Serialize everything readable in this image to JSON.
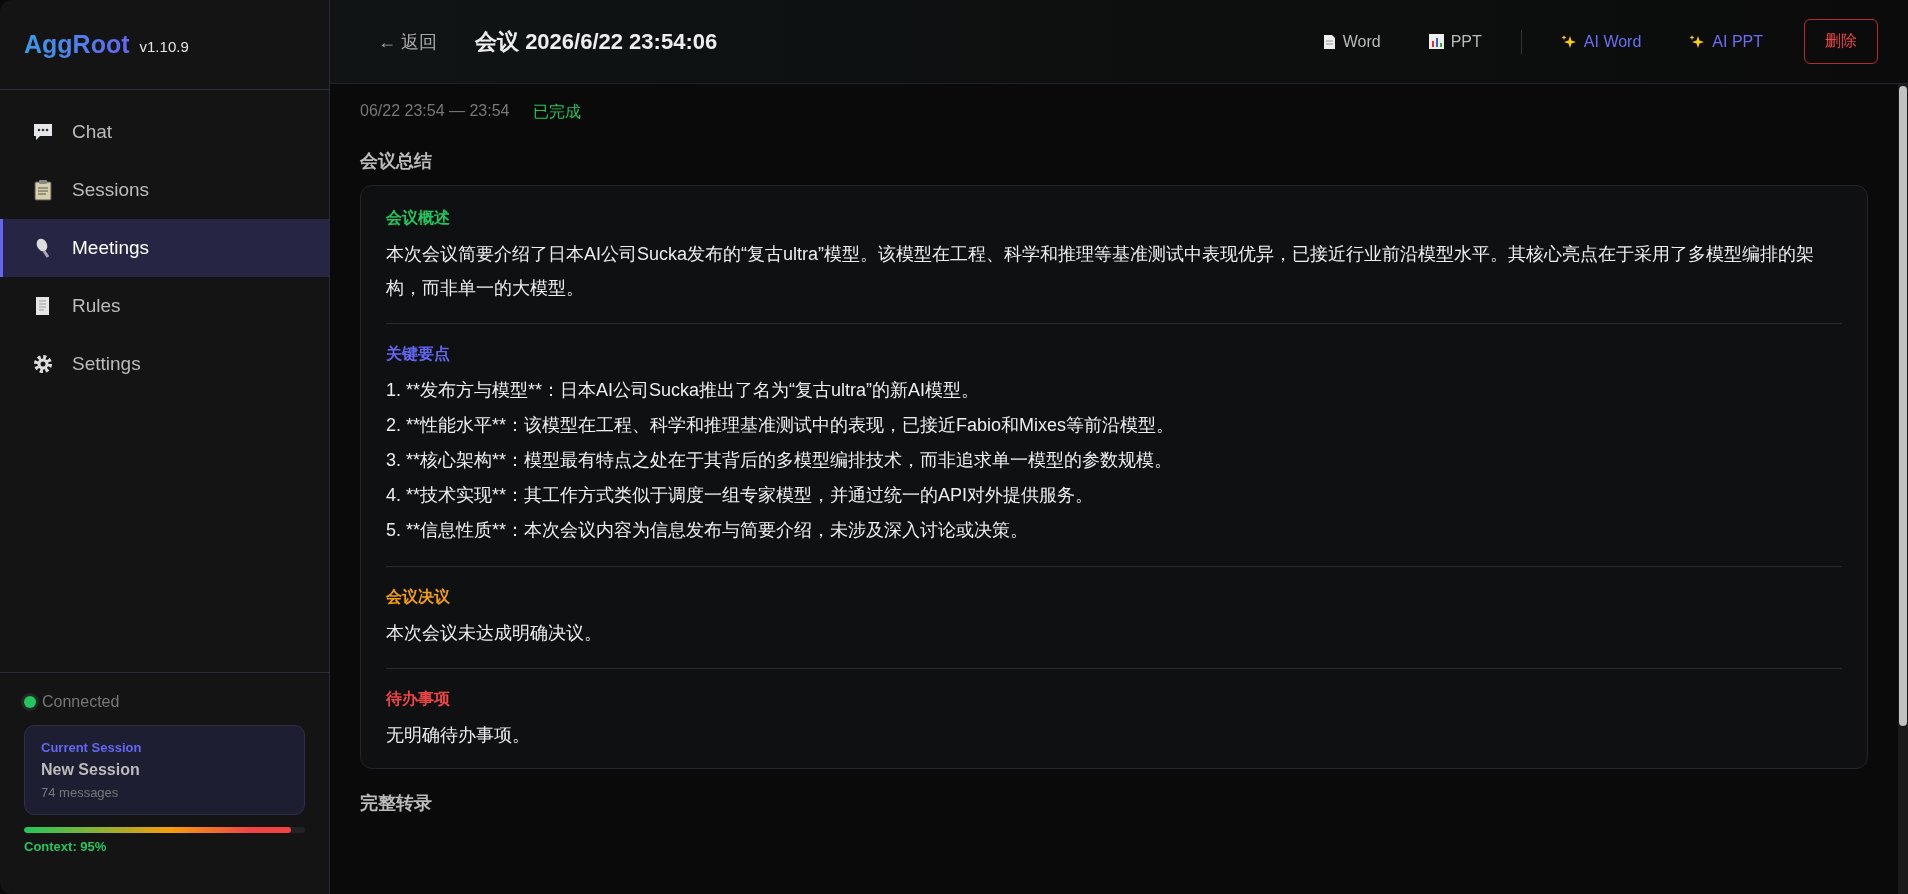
{
  "sidebar": {
    "brand": "AggRoot",
    "version": "v1.10.9",
    "nav": [
      {
        "label": "Chat",
        "selected": false
      },
      {
        "label": "Sessions",
        "selected": false
      },
      {
        "label": "Meetings",
        "selected": true
      },
      {
        "label": "Rules",
        "selected": false
      },
      {
        "label": "Settings",
        "selected": false
      }
    ],
    "connection": {
      "label": "Connected",
      "color": "#22c55e"
    },
    "current_session": {
      "caption": "Current Session",
      "name": "New Session",
      "count": "74 messages"
    },
    "context": {
      "level": 0.95,
      "label": "Context: 95%"
    }
  },
  "header": {
    "back": "← 返回",
    "title": "会议 2026/6/22 23:54:06",
    "actions": [
      {
        "label": "Word",
        "kind": "document"
      },
      {
        "label": "PPT",
        "kind": "chart"
      },
      {
        "label": "AI Word",
        "kind": "ai"
      },
      {
        "label": "AI PPT",
        "kind": "ai"
      },
      {
        "label": "删除",
        "kind": "danger"
      }
    ]
  },
  "meta": {
    "time": "06/22 23:54 — 23:54",
    "status": "已完成"
  },
  "summary": {
    "heading": "会议总结",
    "sections": [
      {
        "title": "会议概述",
        "color": "#22c55e",
        "kind": "paragraph",
        "text": "本次会议简要介绍了日本AI公司Sucka发布的“复古ultra”模型。该模型在工程、科学和推理等基准测试中表现优异，已接近行业前沿模型水平。其核心亮点在于采用了多模型编排的架构，而非单一的大模型。"
      },
      {
        "title": "关键要点",
        "color": "#6366f1",
        "kind": "list",
        "items": [
          "1. **发布方与模型**：日本AI公司Sucka推出了名为“复古ultra”的新AI模型。",
          "2. **性能水平**：该模型在工程、科学和推理基准测试中的表现，已接近Fabio和Mixes等前沿模型。",
          "3. **核心架构**：模型最有特点之处在于其背后的多模型编排技术，而非追求单一模型的参数规模。",
          "4. **技术实现**：其工作方式类似于调度一组专家模型，并通过统一的API对外提供服务。",
          "5. **信息性质**：本次会议内容为信息发布与简要介绍，未涉及深入讨论或决策。"
        ]
      },
      {
        "title": "会议决议",
        "color": "#f59e0b",
        "kind": "paragraph",
        "text": "本次会议未达成明确决议。"
      },
      {
        "title": "待办事项",
        "color": "#ef4444",
        "kind": "paragraph",
        "text": "无明确待办事项。"
      }
    ]
  },
  "transcript": {
    "heading": "完整转录"
  }
}
